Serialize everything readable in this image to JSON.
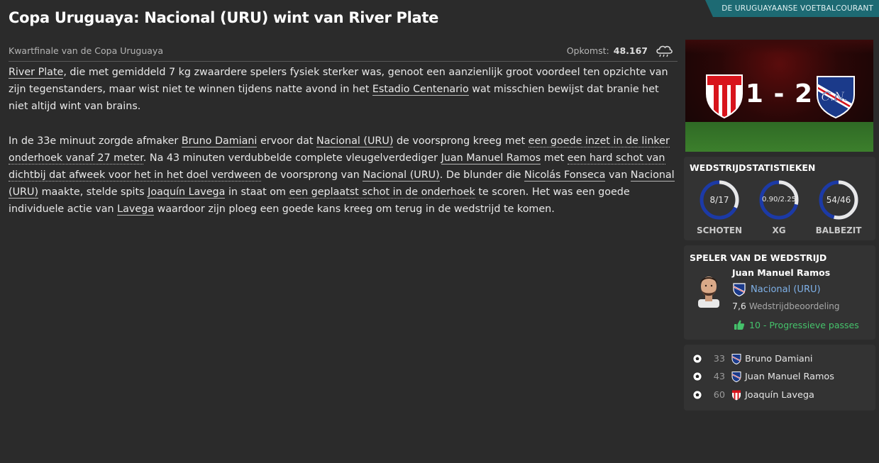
{
  "source_tag": "DE URUGUAYAANSE VOETBALCOURANT",
  "headline": "Copa Uruguaya: Nacional (URU) wint van River Plate",
  "meta": {
    "competition_stage": "Kwartfinale van de Copa Uruguaya",
    "attendance_label": "Opkomst:",
    "attendance_value": "48.167",
    "weather_icon": "rain-cloud-icon"
  },
  "article": {
    "p1": {
      "a": "River Plate",
      "b": ", die met gemiddeld 7 kg zwaardere spelers fysiek sterker was, genoot een aanzienlijk groot voordeel ten opzichte van zijn tegenstanders, maar wist niet te winnen tijdens natte avond in het ",
      "c": "Estadio Centenario",
      "d": " wat misschien bewijst dat branie het niet altijd wint van brains."
    },
    "p2": {
      "t1": "In de 33e minuut zorgde afmaker ",
      "l1": "Bruno Damiani",
      "t2": " ervoor dat ",
      "l2": "Nacional (URU)",
      "t3": " de voorsprong kreeg met ",
      "l3": "een goede inzet in de linker onderhoek vanaf 27 meter",
      "t4": ". Na 43 minuten verdubbelde complete vleugelverdediger ",
      "l4": "Juan Manuel Ramos",
      "t5": " met ",
      "l5": "een hard schot van dichtbij dat afweek voor het in het doel verdween",
      "t6": " de voorsprong van ",
      "l6": "Nacional (URU)",
      "t7": ". De blunder die ",
      "l7": "Nicolás Fonseca",
      "t8": " van ",
      "l8": "Nacional (URU)",
      "t9": " maakte, stelde spits ",
      "l9": "Joaquín Lavega",
      "t10": " in staat om ",
      "l10": "een geplaatst schot in de onderhoek",
      "t11": " te scoren. Het was een goede individuele actie van ",
      "l11": "Lavega",
      "t12": " waardoor zijn ploeg een goede kans kreeg om terug in de wedstrijd te komen."
    }
  },
  "score": {
    "home_goals": "1",
    "separator": "-",
    "away_goals": "2",
    "home_badge_icon": "river-plate-crest-icon",
    "away_badge_icon": "nacional-crest-icon",
    "home_color": "#d8141c",
    "away_color": "#1b3a8a"
  },
  "match_stats": {
    "title": "WEDSTRIJDSTATISTIEKEN",
    "items": [
      {
        "label": "SCHOTEN",
        "value": "8/17",
        "home_share": 0.32
      },
      {
        "label": "XG",
        "value": "0.90/2.25",
        "home_share": 0.29
      },
      {
        "label": "BALBEZIT",
        "value": "54/46",
        "home_share": 0.54
      }
    ],
    "home_ring_color": "#e8e8e8",
    "away_ring_color": "#1c3aa6"
  },
  "player_of_match": {
    "title": "SPELER VAN DE WEDSTRIJD",
    "name": "Juan Manuel Ramos",
    "club": "Nacional (URU)",
    "rating": "7,6",
    "rating_label": "Wedstrijdbeoordeling",
    "highlight": "10 - Progressieve passes",
    "highlight_icon": "thumbs-up-icon"
  },
  "goals": [
    {
      "minute": "33",
      "player": "Bruno Damiani",
      "team_icon": "nacional-crest-icon"
    },
    {
      "minute": "43",
      "player": "Juan Manuel Ramos",
      "team_icon": "nacional-crest-icon"
    },
    {
      "minute": "60",
      "player": "Joaquín Lavega",
      "team_icon": "river-plate-crest-icon"
    }
  ],
  "accent_color": "#1d6a73"
}
